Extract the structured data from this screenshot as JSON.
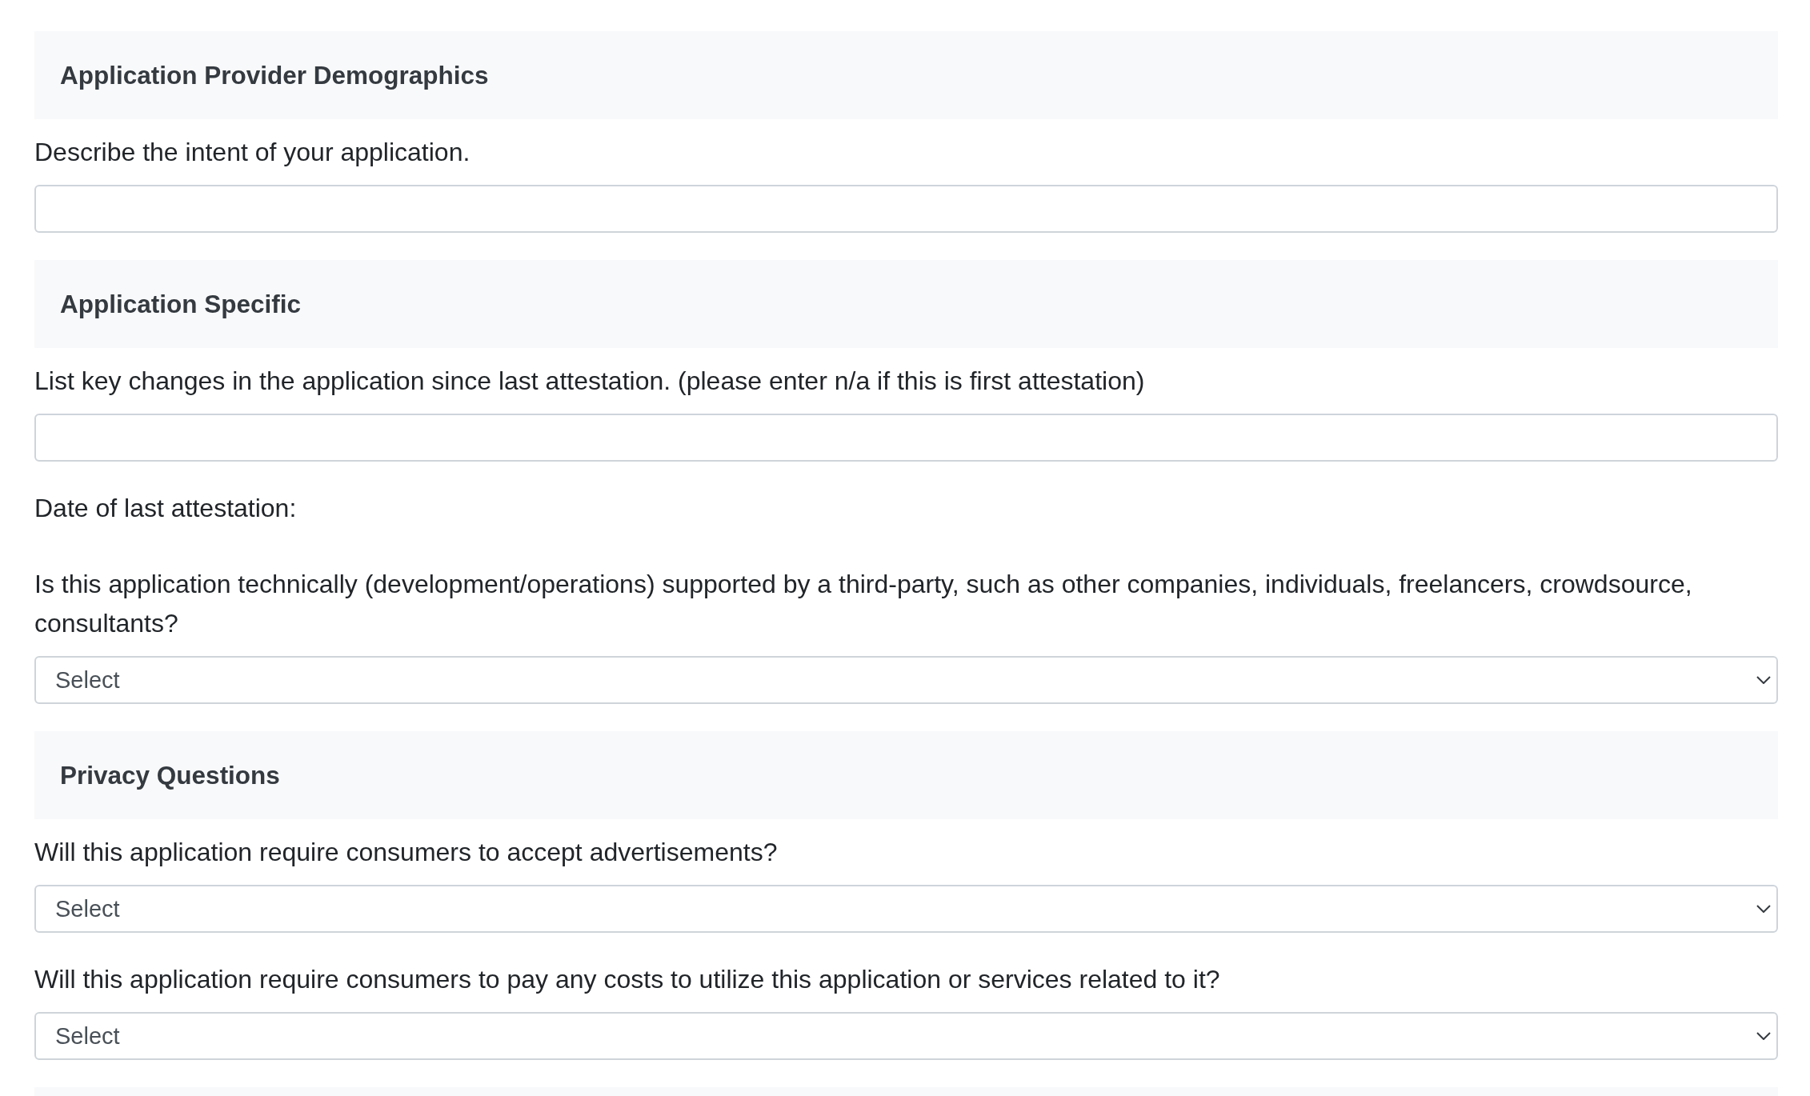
{
  "sections": [
    {
      "title": "Application Provider Demographics",
      "fields": [
        {
          "kind": "text",
          "label": "Describe the intent of your application."
        }
      ]
    },
    {
      "title": "Application Specific",
      "fields": [
        {
          "kind": "text",
          "label": "List key changes in the application since last attestation. (please enter n/a if this is first attestation)"
        },
        {
          "kind": "plain",
          "label": "Date of last attestation:"
        },
        {
          "kind": "select",
          "label": "Is this application technically (development/operations) supported by a third-party, such as other companies, individuals, freelancers, crowdsource, consultants?",
          "value": "Select"
        }
      ]
    },
    {
      "title": "Privacy Questions",
      "fields": [
        {
          "kind": "select",
          "label": "Will this application require consumers to accept advertisements?",
          "value": "Select"
        },
        {
          "kind": "select",
          "label": "Will this application require consumers to pay any costs to utilize this application or services related to it?",
          "value": "Select"
        }
      ]
    }
  ]
}
